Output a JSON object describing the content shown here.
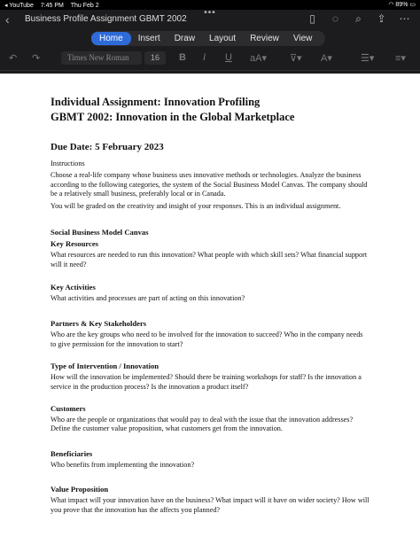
{
  "status": {
    "back_app": "◂ YouTube",
    "time": "7:45 PM",
    "date": "Thu Feb 2",
    "battery": "89%"
  },
  "title_bar": {
    "doc_title": "Business Profile Assignment GBMT 2002"
  },
  "tabs": [
    "Home",
    "Insert",
    "Draw",
    "Layout",
    "Review",
    "View"
  ],
  "ribbon": {
    "font_name": "Times New Roman",
    "font_size": "16"
  },
  "document": {
    "title1": "Individual Assignment: Innovation Profiling",
    "title2": "GBMT 2002: Innovation in the Global Marketplace",
    "due": "Due Date: 5 February 2023",
    "instructions_heading": "Instructions",
    "instructions_p1": "Choose a real-life company whose business uses innovative methods or technologies. Analyze the business according to the following categories, the system of the Social Business Model Canvas. The company should be a relatively small business, preferably local or in Canada.",
    "instructions_p2": "You will be graded on the creativity and insight of your responses. This is an individual assignment.",
    "canvas_heading": "Social Business Model Canvas",
    "sections": [
      {
        "heading": "Key Resources",
        "text": "What resources are needed to run this innovation? What people with which skill sets? What financial support will it need?"
      },
      {
        "heading": "Key Activities",
        "text": "What activities and processes are part of acting on this innovation?"
      },
      {
        "heading": "Partners & Key Stakeholders",
        "text": "Who are the key groups who need to be involved for the innovation to succeed? Who in the company needs to give permission for the innovation to start?"
      },
      {
        "heading": "Type of Intervention / Innovation",
        "text": "How will the innovation be implemented? Should there be training workshops for staff? Is the innovation a service in the production process? Is the innovation a product itself?"
      },
      {
        "heading": "Customers",
        "text": "Who are the people or organizations that would pay to deal with the issue that the innovation addresses? Define the customer value proposition, what customers get from the innovation."
      },
      {
        "heading": "Beneficiaries",
        "text": "Who benefits from implementing the innovation?"
      },
      {
        "heading": "Value Proposition",
        "text": "What impact will your innovation have on the business? What impact will it have on wider society? How will you prove that the innovation has the affects you planned?"
      }
    ]
  }
}
